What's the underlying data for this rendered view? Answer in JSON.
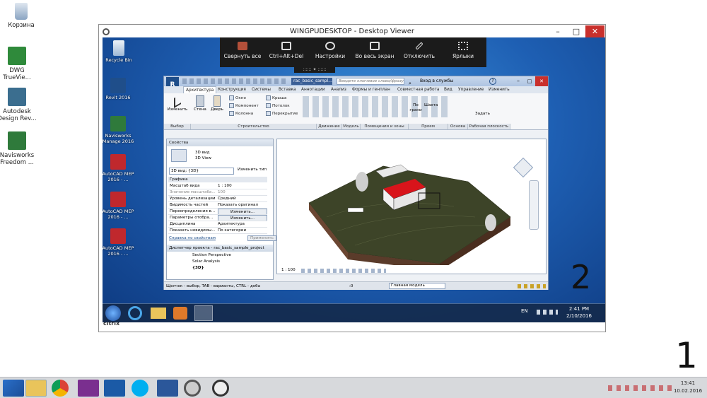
{
  "host_desktop": {
    "icons": [
      {
        "label": "Корзина",
        "icon": "recycle-bin-icon",
        "color": "#8aa4c2"
      },
      {
        "label": "DWG TrueVie...",
        "icon": "dwg-trueview-icon",
        "color": "#2f8a3b"
      },
      {
        "label": "Autodesk Design Rev...",
        "icon": "design-review-icon",
        "color": "#3b6e8f"
      },
      {
        "label": "Navisworks Freedom ...",
        "icon": "navisworks-icon",
        "color": "#2f7a3b"
      }
    ],
    "marker_1": "1",
    "marker_2": "2"
  },
  "host_taskbar": {
    "apps": [
      "start-icon",
      "explorer-icon",
      "chrome-icon",
      "onenote-icon",
      "outlook-icon",
      "skype-icon",
      "word-icon",
      "citrix-icon",
      "citrix-icon"
    ],
    "clock_time": "13:41",
    "clock_date": "10.02.2016"
  },
  "viewer": {
    "title": "WINGPUDESKTOP - Desktop Viewer",
    "brand": "citrix",
    "controls": [
      "–",
      "□",
      "✕"
    ]
  },
  "citrix_toolbar": {
    "buttons": [
      {
        "label": "Свернуть все",
        "icon": "minimize-all-icon"
      },
      {
        "label": "Ctrl+Alt+Del",
        "icon": "keyboard-icon"
      },
      {
        "label": "Настройки",
        "icon": "settings-icon"
      },
      {
        "label": "Во весь экран",
        "icon": "fullscreen-icon"
      },
      {
        "label": "Отключить",
        "icon": "disconnect-icon"
      },
      {
        "label": "Ярлыки",
        "icon": "shortcuts-icon"
      }
    ],
    "handle": ":::::: ✦ ::::::"
  },
  "remote_desktop": {
    "icons": [
      {
        "label": "Recycle Bin",
        "icon": "recycle-bin-icon",
        "color": "#9fb8d6"
      },
      {
        "label": "Revit 2016",
        "icon": "revit-icon",
        "color": "#1f4e8a"
      },
      {
        "label": "Navisworks Manage 2016",
        "icon": "navisworks-manage-icon",
        "color": "#2f7a3b"
      },
      {
        "label": "AutoCAD MEP 2016 - ...",
        "icon": "autocad-mep-icon",
        "color": "#c0282d"
      },
      {
        "label": "AutoCAD MEP 2016 - ...",
        "icon": "autocad-mep-icon",
        "color": "#c0282d"
      },
      {
        "label": "AutoCAD MEP 2016 - ...",
        "icon": "autocad-mep-icon",
        "color": "#c0282d"
      }
    ],
    "taskbar": {
      "lang": "EN",
      "time": "2:41 PM",
      "date": "2/10/2016"
    }
  },
  "revit": {
    "title": "rac_basic_sampl...",
    "search_placeholder": "Введите ключевое слово/фразу",
    "signin": "Вход в службы",
    "tabs": [
      "Архитектура",
      "Конструкция",
      "Системы",
      "Вставка",
      "Аннотации",
      "Анализ",
      "Формы и генплан",
      "Совместная работа",
      "Вид",
      "Управление",
      "Изменить"
    ],
    "ribbon": {
      "modify": "Изменить",
      "wall": "Стена",
      "door": "Дверь",
      "window": "Окно",
      "component": "Компонент",
      "column": "Колонна",
      "roof": "Крыша",
      "ceiling": "Потолок",
      "floor": "Перекрытие",
      "by_face": "По грани",
      "shaft": "Шахта",
      "set": "Задать",
      "groups": [
        "Выбор",
        "Строительство",
        "Движение",
        "Модель",
        "Помещения и зоны",
        "Проем",
        "Основа",
        "Рабочая плоскость"
      ]
    },
    "properties": {
      "header": "Свойства",
      "type_name": "3D вид",
      "type_sub": "3D View",
      "selector": "3D вид: {3D}",
      "edit_type": "Изменить тип",
      "group": "Графика",
      "rows": [
        {
          "k": "Масштаб вида",
          "v": "1 : 100"
        },
        {
          "k": "Значение масштаба...",
          "v": "100"
        },
        {
          "k": "Уровень детализации",
          "v": "Средний"
        },
        {
          "k": "Видимость частей",
          "v": "Показать оригинал"
        },
        {
          "k": "Переопределения в...",
          "v": "Изменить..."
        },
        {
          "k": "Параметры отобра...",
          "v": "Изменить..."
        },
        {
          "k": "Дисциплина",
          "v": "Архитектура"
        },
        {
          "k": "Показать невидимы...",
          "v": "По категории"
        }
      ],
      "help_link": "Справка по свойствам",
      "apply": "Применить"
    },
    "browser": {
      "header": "Диспетчер проекта - rac_basic_sample_project",
      "items": [
        "Section Perspective",
        "Solar Analysis",
        "{3D}"
      ]
    },
    "view_scale": "1 : 100",
    "status_text": "Щелчок - выбор, TAB - варианты, CTRL - доба",
    "model_selector": "Главная модель",
    "status_num": ":0"
  }
}
